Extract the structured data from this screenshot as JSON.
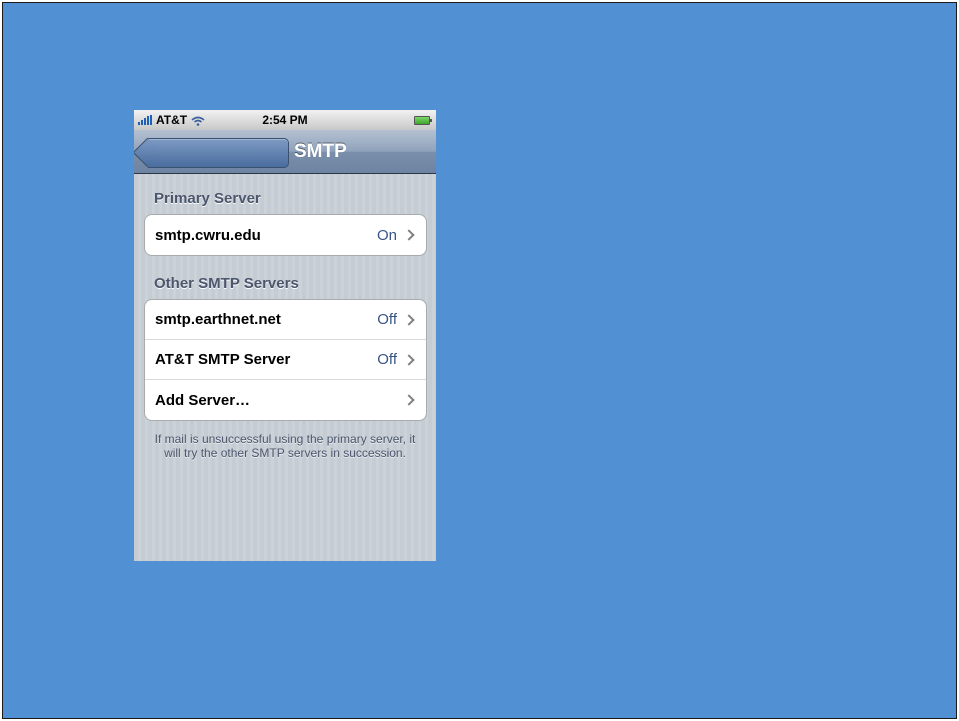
{
  "status_bar": {
    "carrier": "AT&T",
    "time": "2:54 PM"
  },
  "nav": {
    "title": "SMTP",
    "back_label": ""
  },
  "primary": {
    "header": "Primary Server",
    "rows": [
      {
        "label": "smtp.cwru.edu",
        "value": "On"
      }
    ]
  },
  "other": {
    "header": "Other SMTP Servers",
    "rows": [
      {
        "label": "smtp.earthnet.net",
        "value": "Off"
      },
      {
        "label": "AT&T SMTP Server",
        "value": "Off"
      },
      {
        "label": "Add Server…",
        "value": ""
      }
    ]
  },
  "footer": "If mail is unsuccessful using the primary server, it will try the other SMTP servers in succession.",
  "colors": {
    "background": "#5090d3",
    "value_text": "#385487",
    "header_text": "#4c566c"
  }
}
